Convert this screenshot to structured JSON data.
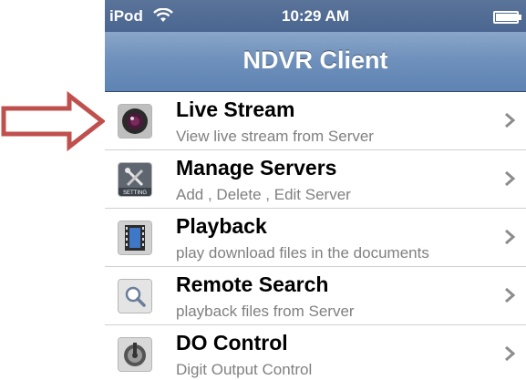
{
  "status_bar": {
    "carrier": "iPod",
    "time": "10:29 AM",
    "battery_level": 0.95
  },
  "nav_bar": {
    "title": "NDVR Client"
  },
  "colors": {
    "pointer_arrow": "#c0504d",
    "nav_bar": "#6d8fbb",
    "subtitle": "#808080"
  },
  "menu": [
    {
      "title": "Live Stream",
      "subtitle": "View live stream from Server",
      "icon": "camera-icon"
    },
    {
      "title": "Manage Servers",
      "subtitle": "Add , Delete , Edit Server",
      "icon": "setting-tools-icon",
      "icon_label": "SETTING"
    },
    {
      "title": "Playback",
      "subtitle": "play download files in the documents",
      "icon": "film-icon"
    },
    {
      "title": "Remote Search",
      "subtitle": "playback files from Server",
      "icon": "magnifier-icon"
    },
    {
      "title": "DO Control",
      "subtitle": "Digit Output Control",
      "icon": "output-dial-icon"
    }
  ]
}
